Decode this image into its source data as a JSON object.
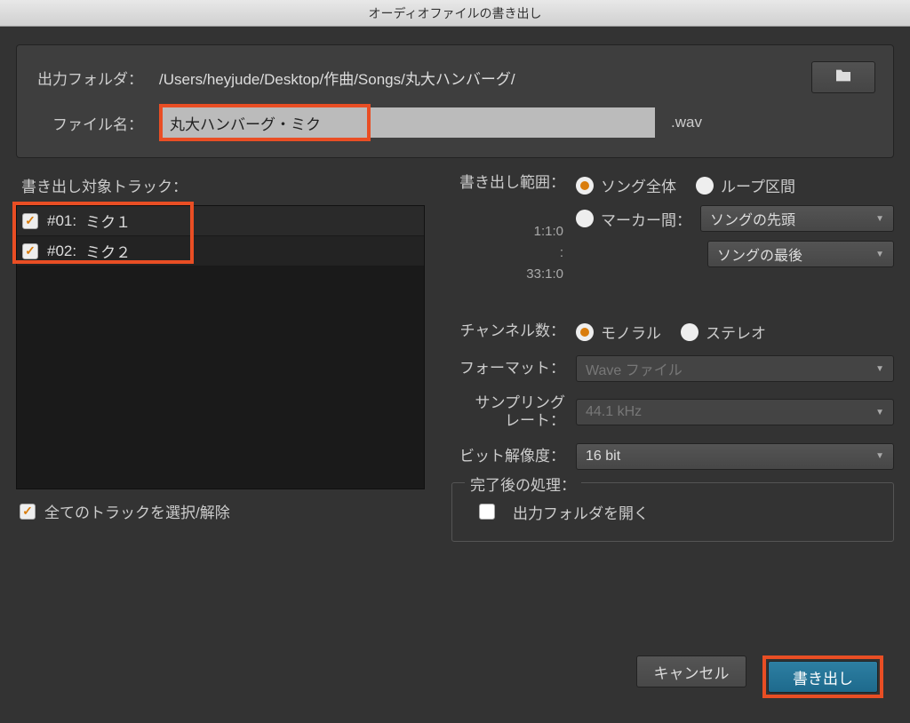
{
  "title": "オーディオファイルの書き出し",
  "top": {
    "folder_label": "出力フォルダ：",
    "folder_path": "/Users/heyjude/Desktop/作曲/Songs/丸大ハンバーグ/",
    "filename_label": "ファイル名：",
    "filename_value": "丸大ハンバーグ・ミク",
    "extension": ".wav"
  },
  "tracks": {
    "label": "書き出し対象トラック：",
    "items": [
      {
        "id": "#01:",
        "name": "ミク１"
      },
      {
        "id": "#02:",
        "name": "ミク２"
      }
    ],
    "select_all": "全てのトラックを選択/解除"
  },
  "range": {
    "label": "書き出し範囲：",
    "opt_song": "ソング全体",
    "opt_loop": "ループ区間",
    "opt_marker": "マーカー間：",
    "time_start": "1:1:0",
    "time_sep": ":",
    "time_end": "33:1:0",
    "marker_from": "ソングの先頭",
    "marker_to": "ソングの最後"
  },
  "channels": {
    "label": "チャンネル数：",
    "mono": "モノラル",
    "stereo": "ステレオ"
  },
  "format": {
    "label": "フォーマット：",
    "value": "Wave ファイル"
  },
  "samplerate": {
    "label_l1": "サンプリング",
    "label_l2": "レート：",
    "value": "44.1 kHz"
  },
  "bitdepth": {
    "label": "ビット解像度：",
    "value": "16 bit"
  },
  "post": {
    "legend": "完了後の処理：",
    "open_folder": "出力フォルダを開く"
  },
  "buttons": {
    "cancel": "キャンセル",
    "export": "書き出し"
  }
}
